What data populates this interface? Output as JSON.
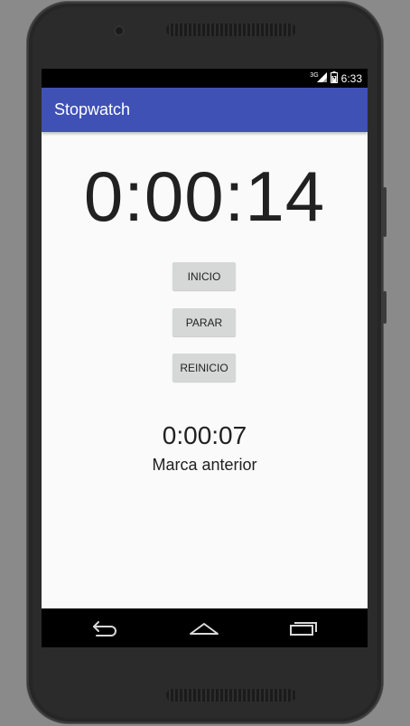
{
  "status_bar": {
    "network": "3G",
    "time": "6:33"
  },
  "app_bar": {
    "title": "Stopwatch"
  },
  "timer": {
    "current": "0:00:14"
  },
  "buttons": {
    "start": "INICIO",
    "stop": "PARAR",
    "reset": "REINICIO"
  },
  "previous": {
    "time": "0:00:07",
    "label": "Marca anterior"
  },
  "nav_bar": {
    "icons": [
      "back-icon",
      "home-icon",
      "recents-icon"
    ]
  },
  "colors": {
    "app_bar": "#3f51b5",
    "button": "#d6d7d7",
    "background": "#fafafa"
  }
}
